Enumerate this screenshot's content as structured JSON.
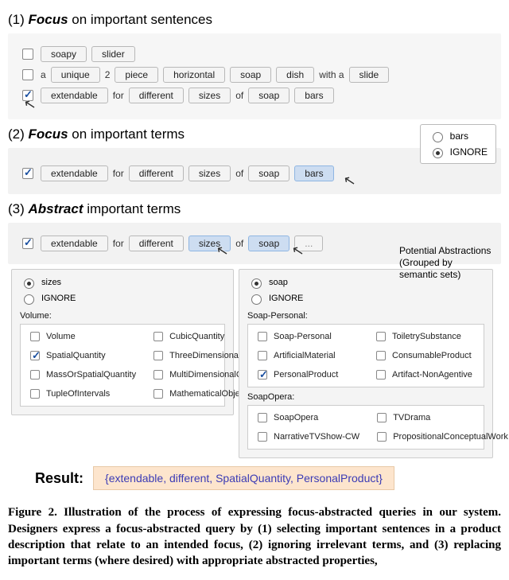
{
  "sections": {
    "s1": {
      "num": "(1)",
      "emph": "Focus",
      "rest": " on important sentences"
    },
    "s2": {
      "num": "(2)",
      "emph": "Focus",
      "rest": " on important terms"
    },
    "s3": {
      "num": "(3)",
      "emph": "Abstract",
      "rest": " important terms"
    }
  },
  "rows": {
    "r1": {
      "t1": "soapy",
      "t2": "slider"
    },
    "r2": {
      "a": "a",
      "t1": "unique",
      "two": "2",
      "t2": "piece",
      "t3": "horizontal",
      "t4": "soap",
      "t5": "dish",
      "with_a": "with a",
      "t6": "slide"
    },
    "r3": {
      "t1": "extendable",
      "for": "for",
      "t2": "different",
      "t3": "sizes",
      "of": "of",
      "t4": "soap",
      "t5": "bars"
    },
    "r4": {
      "t1": "extendable",
      "for": "for",
      "t2": "different",
      "t3": "sizes",
      "of": "of",
      "t4": "soap",
      "t5": "bars"
    },
    "r5": {
      "t1": "extendable",
      "for": "for",
      "t2": "different",
      "t3": "sizes",
      "of": "of",
      "t4": "soap",
      "t5": "..."
    }
  },
  "popover": {
    "opt1": "bars",
    "opt2": "IGNORE"
  },
  "abs": {
    "sizes": {
      "radio1": "sizes",
      "radio2": "IGNORE",
      "group": "Volume:",
      "opts": {
        "o1": "Volume",
        "o2": "CubicQuantity",
        "o3": "SpatialQuantity",
        "o4": "ThreeDimensionalQuantity",
        "o5": "MassOrSpatialQuantity",
        "o6": "MultiDimensionalQuantity",
        "o7": "TupleOfIntervals",
        "o8": "MathematicalObject"
      }
    },
    "soap": {
      "radio1": "soap",
      "radio2": "IGNORE",
      "group1": "Soap-Personal:",
      "opts1": {
        "o1": "Soap-Personal",
        "o2": "ToiletrySubstance",
        "o3": "ArtificialMaterial",
        "o4": "ConsumableProduct",
        "o5": "PersonalProduct",
        "o6": "Artifact-NonAgentive"
      },
      "group2": "SoapOpera:",
      "opts2": {
        "o1": "SoapOpera",
        "o2": "TVDrama",
        "o3": "NarrativeTVShow-CW",
        "o4": "PropositionalConceptualWork"
      }
    },
    "callout": {
      "line1": "Potential Abstractions",
      "line2": "(Grouped by",
      "line3": "semantic sets)"
    }
  },
  "result": {
    "label": "Result:",
    "value": "{extendable, different, SpatialQuantity, PersonalProduct}"
  },
  "caption": "Figure 2.   Illustration of the process of expressing focus-abstracted queries in our system.  Designers express a focus-abstracted query by (1) selecting important sentences in a product description that relate to an intended focus, (2) ignoring irrelevant terms, and (3) replacing important terms (where desired) with appropriate abstracted properties,"
}
